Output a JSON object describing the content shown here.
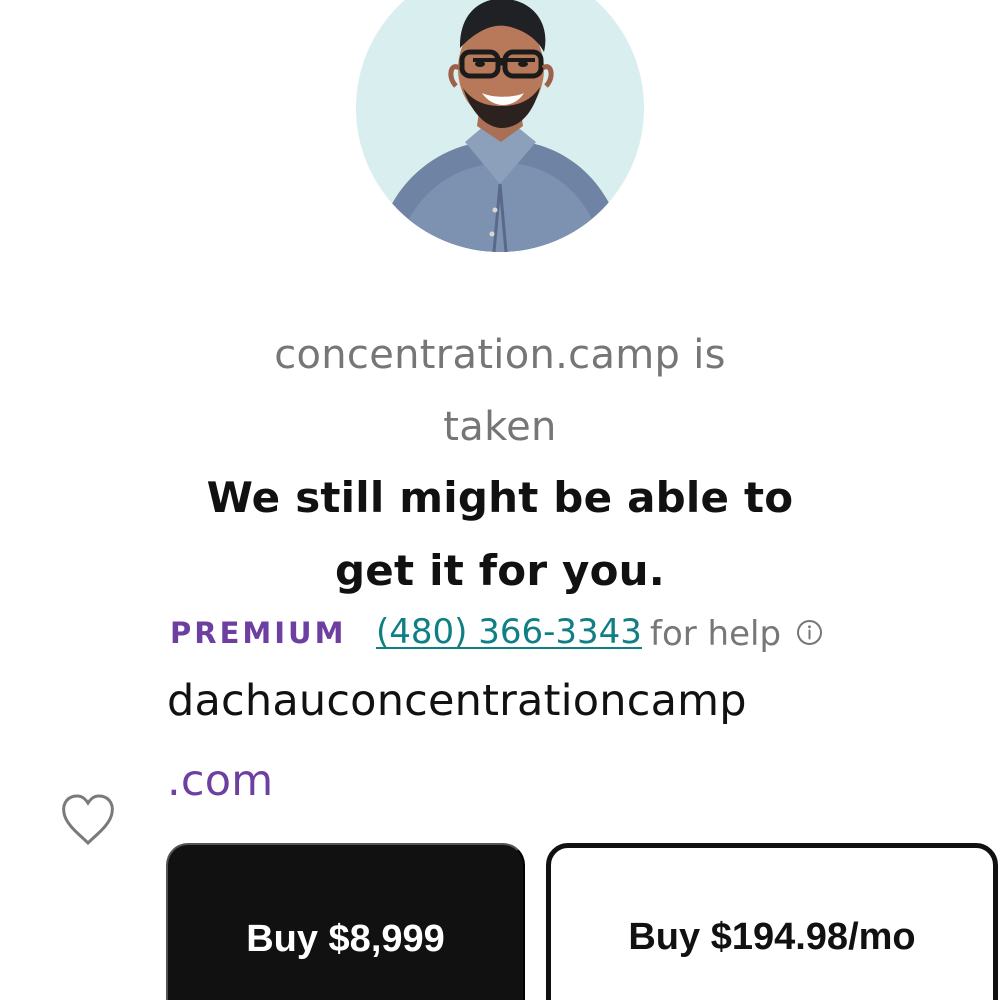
{
  "availability": {
    "line_1": "concentration.camp is",
    "line_2": "taken"
  },
  "headline": {
    "line_1": "We still might be able to",
    "line_2": "get it for you."
  },
  "help": {
    "badge": "PREMIUM",
    "phone": "(480) 366-3343",
    "text": "for help",
    "icon": "info-icon"
  },
  "domain": {
    "name": "dachauconcentrationcamp",
    "tld": ".com"
  },
  "actions": {
    "favorite_icon": "heart-icon",
    "buy_once_label": "Buy $8,999",
    "buy_monthly_label": "Buy $194.98/mo"
  },
  "colors": {
    "premium": "#6d3fa0",
    "phone_link": "#0f7f83",
    "muted_text": "#767676",
    "primary_button": "#111111",
    "avatar_background": "#d9eeee"
  }
}
